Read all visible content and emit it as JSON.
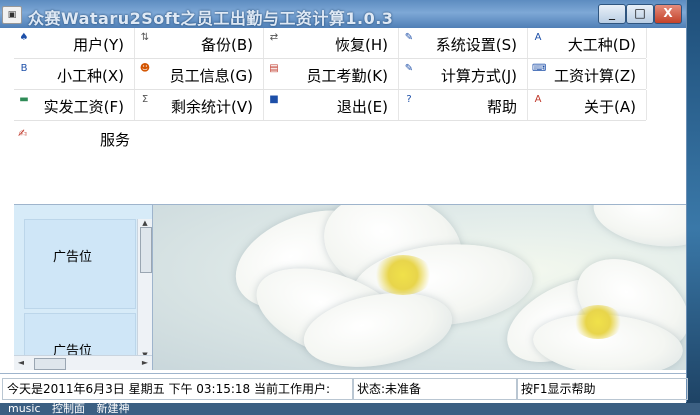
{
  "window": {
    "title": "众赛Wataru2Soft之员工出勤与工资计算1.0.3",
    "controls": {
      "minimize": "_",
      "maximize": "□",
      "close": "X"
    }
  },
  "menu": {
    "rows": [
      [
        {
          "label": "用户(Y)",
          "icon": "user-icon"
        },
        {
          "label": "备份(B)",
          "icon": "backup-icon"
        },
        {
          "label": "恢复(H)",
          "icon": "restore-icon"
        },
        {
          "label": "系统设置(S)",
          "icon": "settings-icon"
        },
        {
          "label": "大工种(D)",
          "icon": "major-worktype-icon"
        }
      ],
      [
        {
          "label": "小工种(X)",
          "icon": "minor-worktype-icon"
        },
        {
          "label": "员工信息(G)",
          "icon": "employee-icon"
        },
        {
          "label": "员工考勤(K)",
          "icon": "attendance-icon"
        },
        {
          "label": "计算方式(J)",
          "icon": "calc-method-icon"
        },
        {
          "label": "工资计算(Z)",
          "icon": "keyboard-icon"
        }
      ],
      [
        {
          "label": "实发工资(F)",
          "icon": "money-icon"
        },
        {
          "label": "剩余统计(V)",
          "icon": "sigma-icon"
        },
        {
          "label": "退出(E)",
          "icon": "exit-icon"
        },
        {
          "label": "帮助",
          "icon": "help-icon"
        },
        {
          "label": "关于(A)",
          "icon": "about-icon"
        }
      ]
    ],
    "service": {
      "label": "服务",
      "icon": "service-icon"
    }
  },
  "ads": [
    {
      "text": "广告位"
    },
    {
      "text": "广告位"
    }
  ],
  "status": {
    "datetime": "今天是2011年6月3日  星期五  下午  03:15:18  当前工作用户:",
    "state": "状态:未准备",
    "help": "按F1显示帮助"
  },
  "taskbar": {
    "items": [
      "music",
      "控制面",
      "新建神"
    ]
  }
}
